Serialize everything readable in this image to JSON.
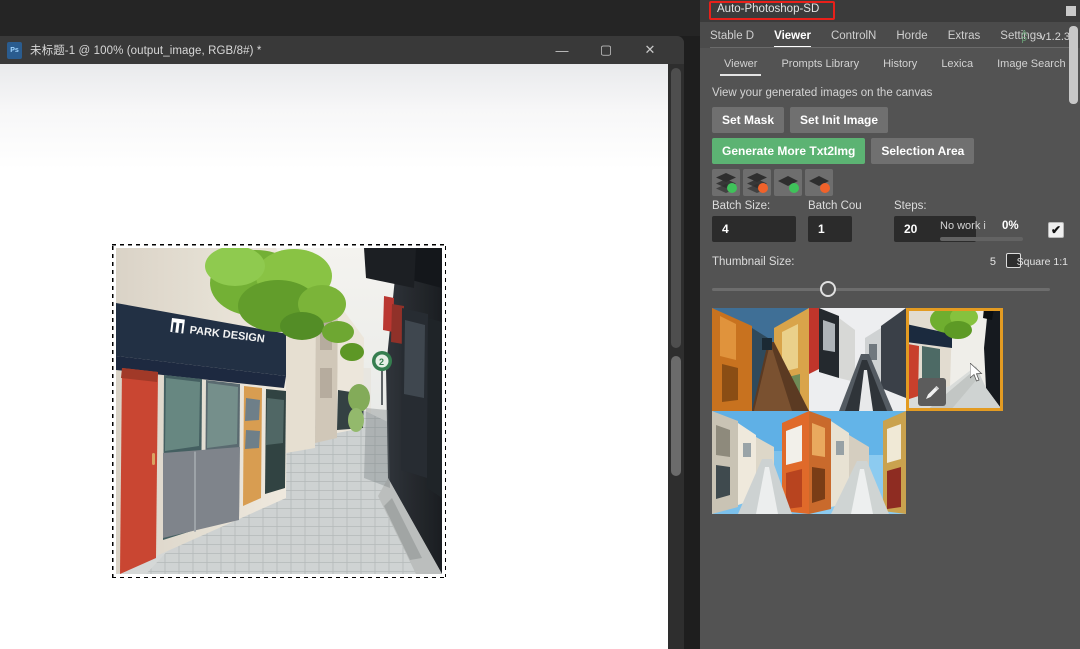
{
  "photoshop": {
    "doc_icon": "photoshop-document-icon",
    "title": "未标题-1 @ 100% (output_image, RGB/8#) *",
    "window_controls": {
      "minimize": "—",
      "maximize": "▢",
      "close": "✕"
    }
  },
  "plugin": {
    "header_title": "Auto-Photoshop-SD",
    "main_tabs": [
      {
        "label": "Stable D",
        "active": false
      },
      {
        "label": "Viewer",
        "active": true
      },
      {
        "label": "ControlN",
        "active": false
      },
      {
        "label": "Horde",
        "active": false
      },
      {
        "label": "Extras",
        "active": false
      },
      {
        "label": "Settings",
        "active": false
      }
    ],
    "logo_top": "A",
    "logo_bottom": "P",
    "version": "v1.2.3",
    "sub_tabs": [
      {
        "label": "Viewer",
        "active": true
      },
      {
        "label": "Prompts Library",
        "active": false
      },
      {
        "label": "History",
        "active": false
      },
      {
        "label": "Lexica",
        "active": false
      },
      {
        "label": "Image Search",
        "active": false
      }
    ],
    "hint": "View your generated images on the canvas",
    "buttons": {
      "set_mask": "Set Mask",
      "set_init_image": "Set Init Image",
      "generate_more": "Generate More Txt2Img",
      "selection_area": "Selection Area"
    },
    "mode_icons": [
      {
        "name": "layers-stack-active-icon",
        "status": "green"
      },
      {
        "name": "layers-stack-warning-icon",
        "status": "orange"
      },
      {
        "name": "layer-single-active-icon",
        "status": "green"
      },
      {
        "name": "layer-single-warning-icon",
        "status": "orange"
      }
    ],
    "params": {
      "batch_size_label": "Batch Size:",
      "batch_size_value": "4",
      "batch_count_label": "Batch Cou",
      "batch_count_value": "1",
      "steps_label": "Steps:",
      "steps_value": "20"
    },
    "status": {
      "text": "No work i",
      "percent": "0%",
      "checkbox_checked": true,
      "check_glyph": "✔"
    },
    "thumbnail_size": {
      "label": "Thumbnail Size:",
      "value": "5",
      "square_label": "Square 1:1",
      "square_checked": false
    },
    "gallery": {
      "thumbs": [
        {
          "name": "thumbnail-1",
          "selected": false
        },
        {
          "name": "thumbnail-2",
          "selected": false
        },
        {
          "name": "thumbnail-3",
          "selected": true
        },
        {
          "name": "thumbnail-4",
          "selected": false
        },
        {
          "name": "thumbnail-5",
          "selected": false
        }
      ],
      "edit_badge": "pencil-edit-icon"
    },
    "colors": {
      "accent_green": "#5cb373",
      "selection_orange": "#e39b22",
      "highlight_red": "#e8201a",
      "panel_bg": "#535353"
    }
  }
}
